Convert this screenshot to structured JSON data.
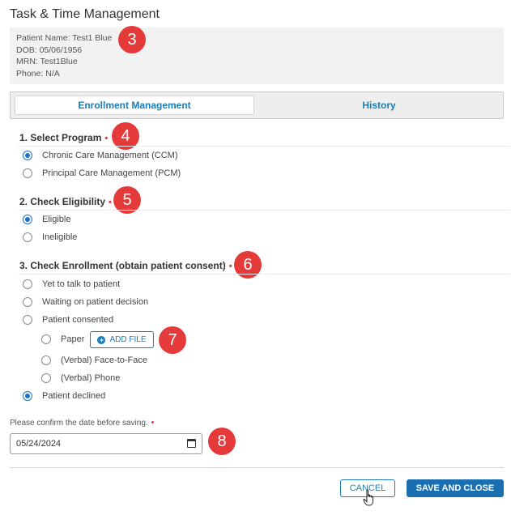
{
  "title": "Task & Time Management",
  "patient": {
    "name": "Patient Name: Test1 Blue",
    "dob": "DOB: 05/06/1956",
    "mrn": "MRN: Test1Blue",
    "phone": "Phone: N/A"
  },
  "tabs": [
    {
      "label": "Enrollment Management",
      "active": true
    },
    {
      "label": "History",
      "active": false
    }
  ],
  "sections": {
    "program": {
      "title": "1. Select Program",
      "options": [
        {
          "label": "Chronic Care Management (CCM)",
          "checked": true
        },
        {
          "label": "Principal Care Management (PCM)",
          "checked": false
        }
      ]
    },
    "eligibility": {
      "title": "2. Check Eligibility",
      "options": [
        {
          "label": "Eligible",
          "checked": true
        },
        {
          "label": "Ineligible",
          "checked": false
        }
      ]
    },
    "enrollment": {
      "title": "3. Check Enrollment (obtain patient consent)",
      "options": [
        {
          "label": "Yet to talk to patient",
          "checked": false
        },
        {
          "label": "Waiting on patient decision",
          "checked": false
        },
        {
          "label": "Patient consented",
          "checked": false
        },
        {
          "label": "Patient declined",
          "checked": true
        }
      ],
      "consent_options": [
        {
          "label": "Paper",
          "checked": false
        },
        {
          "label": "(Verbal) Face-to-Face",
          "checked": false
        },
        {
          "label": "(Verbal) Phone",
          "checked": false
        }
      ],
      "add_file_label": "ADD FILE"
    }
  },
  "required_marker": "•",
  "date": {
    "label": "Please confirm the date before saving.",
    "value": "05/24/2024"
  },
  "buttons": {
    "cancel": "CANCEL",
    "save": "SAVE AND CLOSE"
  },
  "badges": [
    "3",
    "4",
    "5",
    "6",
    "7",
    "8"
  ],
  "icons": {
    "plus": "plus-circle-icon",
    "calendar": "calendar-icon",
    "cursor": "hand-pointer-icon"
  },
  "colors": {
    "accent": "#1a7cb8",
    "primary_button": "#1a6fb0",
    "badge": "#e53a3a",
    "required": "#d9363e"
  }
}
